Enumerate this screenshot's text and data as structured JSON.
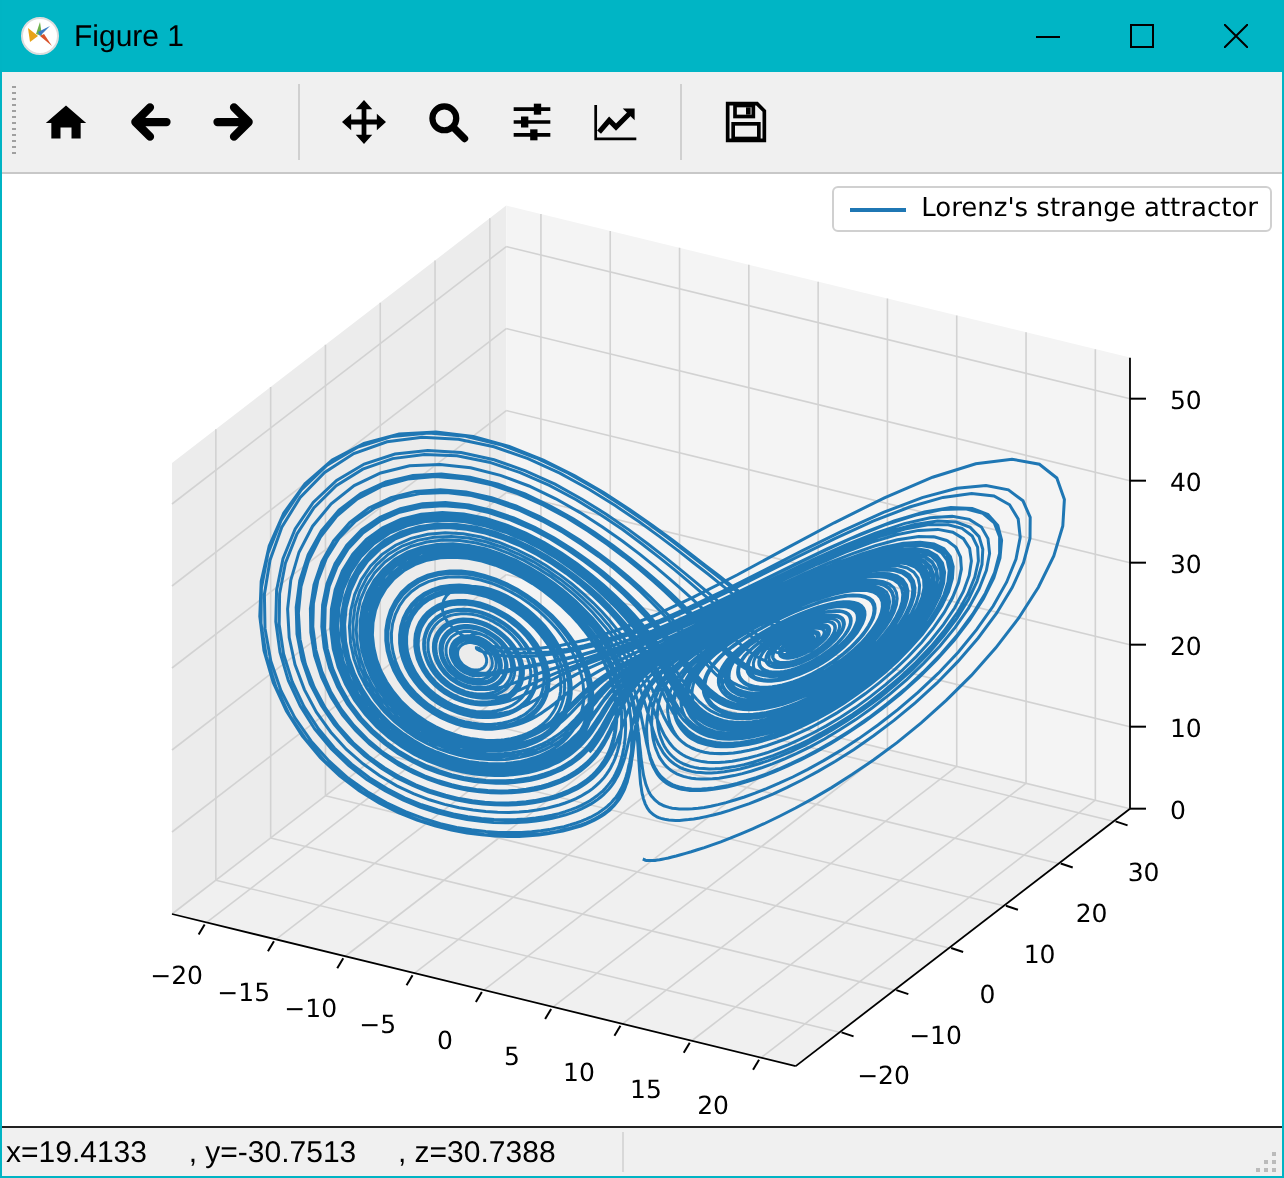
{
  "window": {
    "title": "Figure 1"
  },
  "plot": {
    "legend": {
      "label": "Lorenz's strange attractor"
    },
    "x_tick_labels": [
      "−20",
      "−15",
      "−10",
      "−5",
      "0",
      "5",
      "10",
      "15",
      "20"
    ],
    "y_tick_labels": [
      "−20",
      "−10",
      "0",
      "10",
      "20",
      "30"
    ],
    "z_tick_labels": [
      "50",
      "40",
      "30",
      "20",
      "10",
      "0"
    ]
  },
  "status_bar": {
    "text": "x=19.4133     , y=-30.7513     , z=30.7388"
  }
}
